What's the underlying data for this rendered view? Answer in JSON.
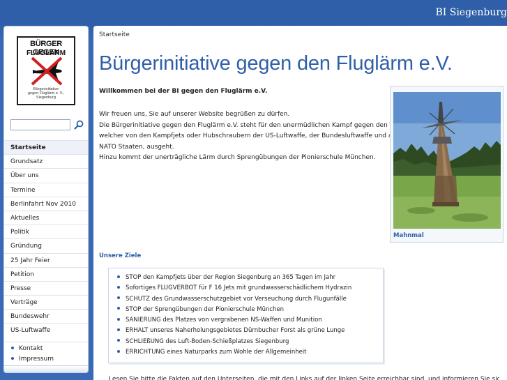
{
  "site": {
    "title": "BI Siegenburg"
  },
  "logo": {
    "line1": "BÜRGER GEGEN",
    "line2": "FLUGLÄRM",
    "small": [
      "Bürgerinitiative",
      "gegen Fluglärm e. V.,",
      "Siegenburg"
    ]
  },
  "search": {
    "value": "",
    "placeholder": "",
    "icon": "search-icon"
  },
  "sidebar": {
    "items": [
      {
        "label": "Startseite",
        "active": true
      },
      {
        "label": "Grundsatz"
      },
      {
        "label": "Über uns"
      },
      {
        "label": "Termine"
      },
      {
        "label": "Berlinfahrt Nov 2010"
      },
      {
        "label": "Aktuelles"
      },
      {
        "label": "Politik"
      },
      {
        "label": "Gründung"
      },
      {
        "label": "25 Jahr Feier"
      },
      {
        "label": "Petition"
      },
      {
        "label": "Presse"
      },
      {
        "label": "Verträge"
      },
      {
        "label": "Bundeswehr"
      },
      {
        "label": "US-Luftwaffe"
      }
    ],
    "sub_items": [
      {
        "label": "Kontakt"
      },
      {
        "label": "Impressum"
      }
    ]
  },
  "main": {
    "breadcrumb": "Startseite",
    "title": "Bürgerinitiative gegen den Fluglärm e.V.",
    "welcome": "Willkommen bei der BI gegen den Fluglärm e.V.",
    "intro": [
      "Wir freuen uns, Sie auf unserer Website begrüßen zu dürfen.",
      "Die Bürgerinitiative gegen den Fluglärm e.V. steht für den unermüdlichen Kampf gegen den Terror,",
      "welcher von den Kampfjets oder Hubschraubern der US-Luftwaffe, der Bundesluftwaffe und anderen",
      "NATO Staaten, ausgeht.",
      "Hinzu kommt der unerträgliche Lärm durch Sprengübungen der Pionierschule München."
    ],
    "photo_caption": "Mahnmal",
    "goals_heading": "Unsere Ziele",
    "goals": [
      "STOP den Kampfjets über der Region Siegenburg an 365 Tagen im Jahr",
      "Sofortiges FLUGVERBOT für F 16 Jets mit grundwasserschädlichem Hydrazin",
      "SCHUTZ des Grundwasserschutzgebiet vor Verseuchung durch Flugunfälle",
      "STOP der Sprengübungen der Pionierschule München",
      "SANIERUNG des Platzes von vergrabenen NS-Waffen und Munition",
      "ERHALT unseres Naherholungsgebietes Dürnbucher Forst als grüne Lunge",
      "SCHLIEßUNG des Luft-Boden-Schießplatzes Siegenburg",
      "ERRICHTUNG eines Naturparks zum Wohle der Allgemeinheit"
    ],
    "cut_text": "Lesen Sie bitte die Fakten auf den Unterseiten, die mit den Links auf der linken Seite erreichbar sind, und informieren Sie sich"
  },
  "colors": {
    "accent": "#2f5fa8",
    "background": "#3a6ab6"
  }
}
